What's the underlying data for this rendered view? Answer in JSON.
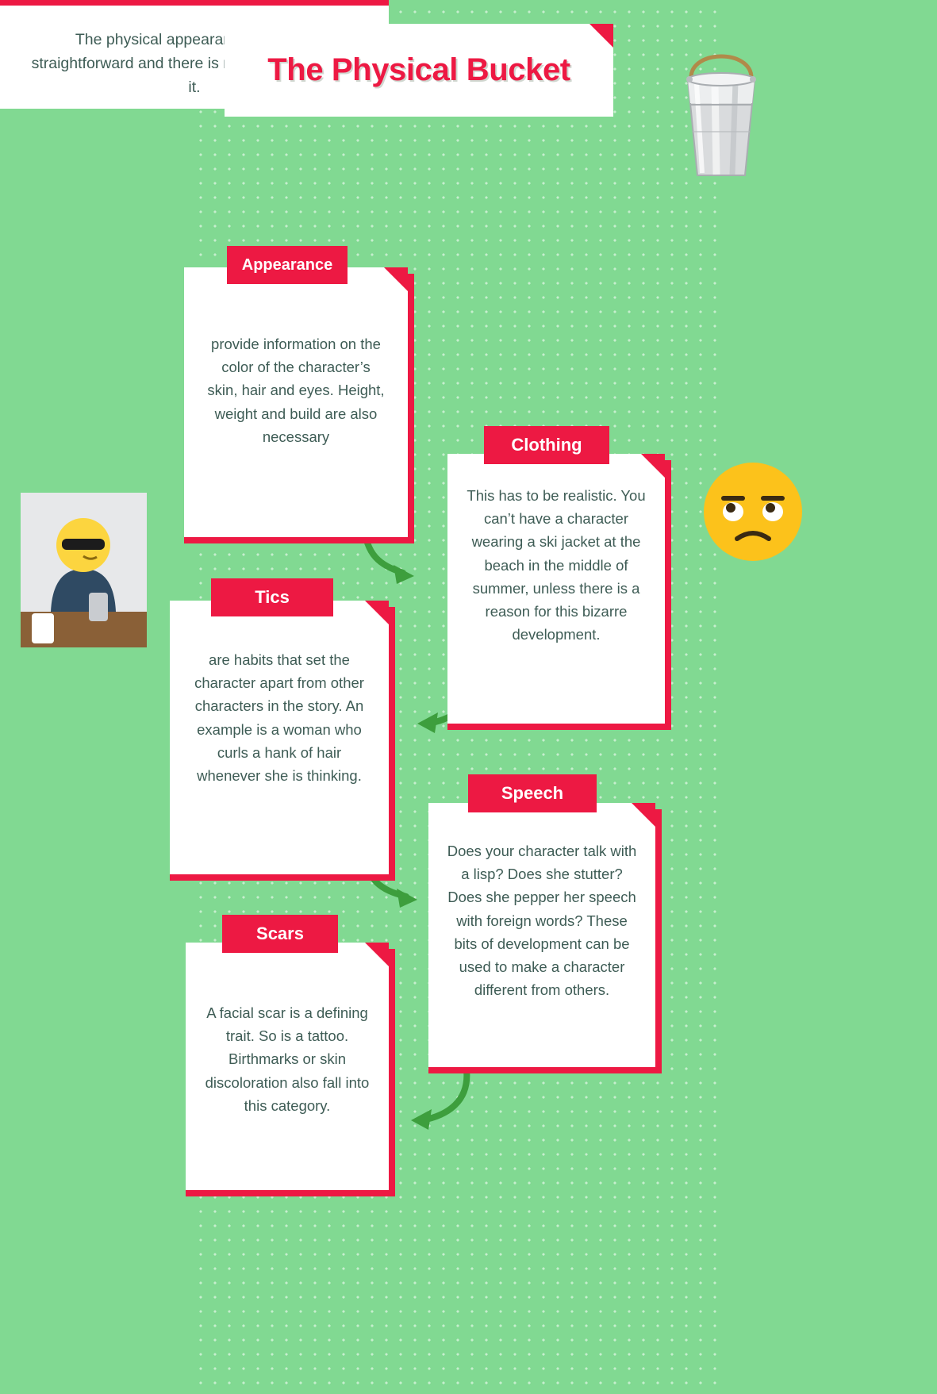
{
  "colors": {
    "background_green": "#81d992",
    "accent_red": "#ed1943",
    "text_slate": "#3e5c55",
    "arrow_green": "#3d9e3d",
    "card_white": "#ffffff"
  },
  "header": {
    "title": "The Physical Bucket",
    "subtitle": "The physical appearance bucket is straightforward and there is nothing tricky about it."
  },
  "decorations": {
    "bucket_icon": "metal-bucket-illustration",
    "emoji_icon": "unamused-face-emoji",
    "photo_icon": "person-with-smiley-emoji-head-photo"
  },
  "cards": [
    {
      "id": "appearance",
      "label": "Appearance",
      "body": "provide information on the color of the character’s skin, hair and eyes. Height, weight and build are also necessary"
    },
    {
      "id": "clothing",
      "label": "Clothing",
      "body": "This has to be realistic. You can’t have a character wearing a ski jacket at the beach in the middle of summer, unless there is a reason for this bizarre development."
    },
    {
      "id": "tics",
      "label": "Tics",
      "body": "are habits that set the character apart from other characters in the story. An example is a woman who curls a hank of hair whenever she is thinking."
    },
    {
      "id": "speech",
      "label": "Speech",
      "body": "Does your character talk with a lisp? Does she stutter? Does she pepper her speech with foreign words? These bits of development can be used to make a character different from others."
    },
    {
      "id": "scars",
      "label": "Scars",
      "body": "A facial scar is a defining trait. So is a tattoo. Birthmarks or skin discoloration also fall into this category."
    }
  ],
  "arrows": [
    {
      "id": "appearance-to-clothing",
      "direction": "down-right"
    },
    {
      "id": "clothing-to-tics",
      "direction": "down-left"
    },
    {
      "id": "tics-to-speech",
      "direction": "down-right"
    },
    {
      "id": "speech-to-scars",
      "direction": "down-left"
    }
  ]
}
